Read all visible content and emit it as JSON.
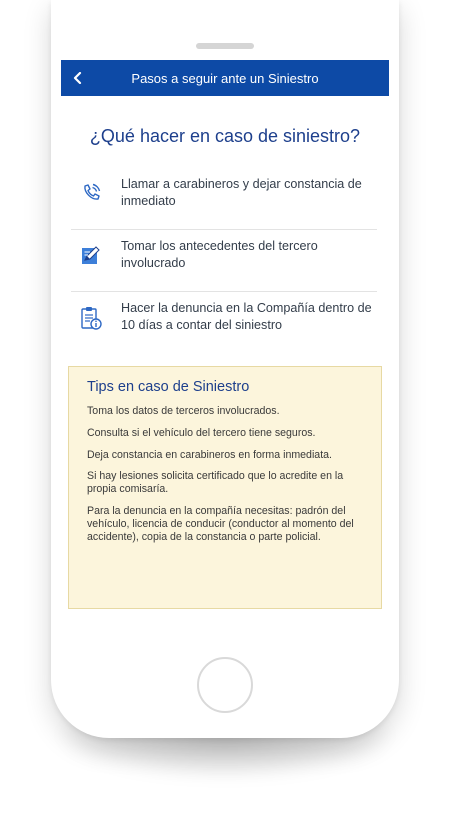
{
  "header": {
    "title": "Pasos a seguir ante un Siniestro",
    "back_icon": "chevron-left-icon"
  },
  "main": {
    "heading": "¿Qué hacer en caso de siniestro?",
    "steps": [
      {
        "icon": "phone-call-icon",
        "text": "Llamar  a carabineros y dejar constancia de inmediato"
      },
      {
        "icon": "edit-document-icon",
        "text": "Tomar los antecedentes del tercero involucrado"
      },
      {
        "icon": "clipboard-info-icon",
        "text": "Hacer la denuncia en la Compañía dentro de 10 días a contar del siniestro"
      }
    ]
  },
  "tips": {
    "title": "Tips en caso de Siniestro",
    "items": [
      "Toma los datos de terceros involucrados.",
      "Consulta si el vehículo del tercero tiene seguros.",
      "Deja constancia en carabineros en forma  inmediata.",
      "Si hay lesiones solicita certificado que lo acredite en la propia comisaría.",
      "Para la denuncia en la compañía necesitas: padrón del vehículo, licencia de conducir (conductor al momento del accidente), copia de la constancia o parte policial."
    ]
  },
  "colors": {
    "appbar": "#0d4aa6",
    "heading": "#1d3f8c",
    "tips_bg": "#fcf5dc",
    "tips_border": "#e7d9a3"
  }
}
